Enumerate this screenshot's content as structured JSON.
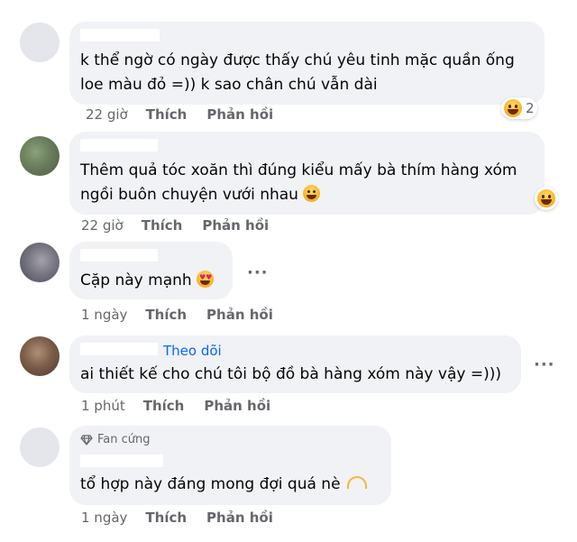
{
  "comments": [
    {
      "text": "k thể ngờ có ngày được thấy chú yêu tinh mặc quần ống\nloe màu đỏ =)) k sao chân chú vẫn dài",
      "time": "22 giờ",
      "like": "Thích",
      "reply": "Phản hồi",
      "reaction_count": "2"
    },
    {
      "text": "Thêm quả tóc xoăn thì đúng kiểu mấy bà thím hàng xóm\nngồi buôn chuyện vưới nhau",
      "time": "22 giờ",
      "like": "Thích",
      "reply": "Phản hồi"
    },
    {
      "text": "Cặp này mạnh",
      "time": "1 ngày",
      "like": "Thích",
      "reply": "Phản hồi"
    },
    {
      "text": "ai thiết kế cho chú tôi bộ đồ bà hàng xóm này vậy =)))",
      "follow": "Theo dõi",
      "time": "1 phút",
      "like": "Thích",
      "reply": "Phản hồi"
    },
    {
      "badge": "Fan cứng",
      "text": "tổ hợp này đáng mong đợi quá nè",
      "time": "1 ngày",
      "like": "Thích",
      "reply": "Phản hồi"
    }
  ],
  "more_glyph": "···",
  "icons": {
    "reaction": "laughing-face-icon",
    "heart_eyes": "heart-eyes-icon",
    "sweat_laugh": "grinning-sweat-icon",
    "heart_hands": "heart-hands-icon",
    "diamond": "diamond-icon",
    "more": "more-options-icon"
  },
  "colors": {
    "bubble": "#f0f2f5",
    "link": "#0866ff",
    "meta": "#65676b"
  }
}
